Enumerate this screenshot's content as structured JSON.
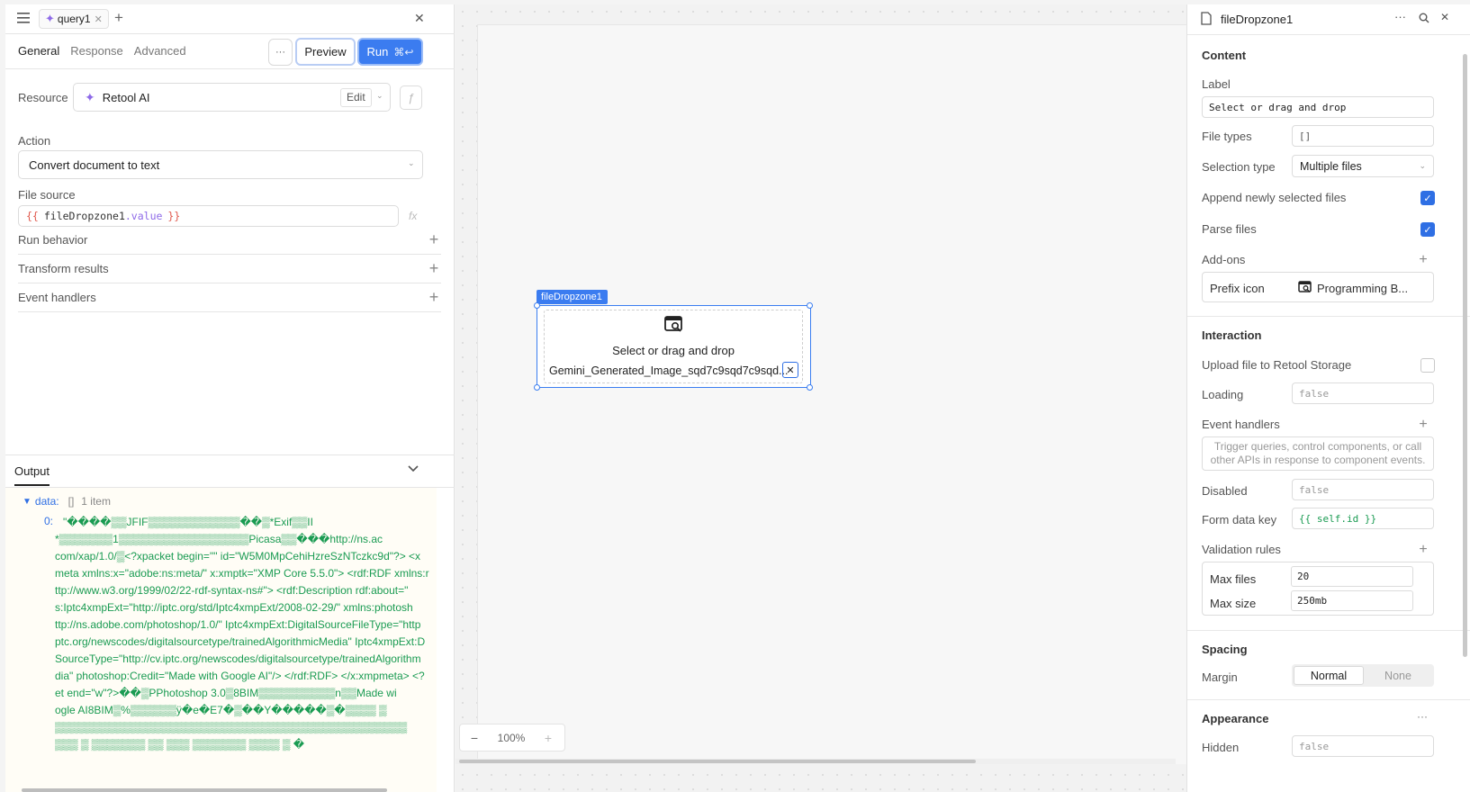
{
  "query": {
    "tab_name": "query1",
    "tabs": [
      "General",
      "Response",
      "Advanced"
    ],
    "preview_label": "Preview",
    "run_label": "Run",
    "run_shortcut": "⌘↩",
    "more_label": "···",
    "resource_label": "Resource",
    "resource_value": "Retool AI",
    "edit_label": "Edit",
    "action_label": "Action",
    "action_value": "Convert document to text",
    "file_source_label": "File source",
    "file_source_open": "{{",
    "file_source_expr": "fileDropzone1",
    "file_source_prop": ".value",
    "file_source_close": "}}",
    "fx_label": "fx",
    "sections": [
      "Run behavior",
      "Transform results",
      "Event handlers"
    ]
  },
  "output": {
    "title": "Output",
    "data_key": "data:",
    "data_bracket": "[]",
    "data_count": "1 item",
    "item_index": "0:",
    "lines": [
      "\"����▒▒JFIF▒▒▒▒▒▒▒▒▒▒▒▒��▒*Exif▒▒II",
      "*▒▒▒▒▒▒▒1▒▒▒▒▒▒▒▒▒▒▒▒▒▒▒▒▒Picasa▒▒���http://ns.ac",
      "com/xap/1.0/▒<?xpacket begin=\"\" id=\"W5M0MpCehiHzreSzNTczkc9d\"?> <x",
      "meta xmlns:x=\"adobe:ns:meta/\" x:xmptk=\"XMP Core 5.5.0\"> <rdf:RDF xmlns:r",
      "ttp://www.w3.org/1999/02/22-rdf-syntax-ns#\"> <rdf:Description rdf:about=\"",
      "s:Iptc4xmpExt=\"http://iptc.org/std/Iptc4xmpExt/2008-02-29/\" xmlns:photosh",
      "ttp://ns.adobe.com/photoshop/1.0/\" Iptc4xmpExt:DigitalSourceFileType=\"http",
      "ptc.org/newscodes/digitalsourcetype/trainedAlgorithmicMedia\" Iptc4xmpExt:D",
      "SourceType=\"http://cv.iptc.org/newscodes/digitalsourcetype/trainedAlgorithm",
      "dia\" photoshop:Credit=\"Made with Google AI\"/> </rdf:RDF> </x:xmpmeta> <?",
      "et end=\"w\"?>��▒PPhotoshop 3.0▒8BIM▒▒▒▒▒▒▒▒▒▒n▒▒Made wi",
      "ogle AI8BIM▒%▒▒▒▒▒▒ÿ�e�E7�▒��Y�����▒�▒▒▒▒ ▒",
      "▒▒▒▒▒▒▒▒▒▒▒▒▒▒▒▒▒▒▒▒▒▒▒▒▒▒▒▒▒▒▒▒▒▒▒▒▒▒▒▒▒▒▒▒▒▒",
      "▒▒▒ ▒ ▒▒▒▒▒▒▒ ▒▒ ▒▒▒ ▒▒▒▒▒▒▒ ▒▒▒▒ ▒ �"
    ]
  },
  "canvas": {
    "component_tag": "fileDropzone1",
    "dropzone_label": "Select or drag and drop",
    "file_name": "Gemini_Generated_Image_sqd7c9sqd7c9sqd...",
    "zoom": "100%",
    "zoom_minus": "−",
    "zoom_plus": "+"
  },
  "inspector": {
    "title": "fileDropzone1",
    "content_title": "Content",
    "label_label": "Label",
    "label_value": "Select or drag and drop",
    "file_types_label": "File types",
    "file_types_value": "[]",
    "selection_type_label": "Selection type",
    "selection_type_value": "Multiple files",
    "append_label": "Append newly selected files",
    "parse_label": "Parse files",
    "addons_label": "Add-ons",
    "prefix_icon_label": "Prefix icon",
    "prefix_icon_value": "Programming B...",
    "interaction_title": "Interaction",
    "upload_label": "Upload file to Retool Storage",
    "loading_label": "Loading",
    "loading_value": "false",
    "event_handlers_label": "Event handlers",
    "event_handlers_hint": "Trigger queries, control components, or call other APIs in response to component events.",
    "disabled_label": "Disabled",
    "disabled_value": "false",
    "form_key_label": "Form data key",
    "form_key_value": "{{ self.id }}",
    "validation_label": "Validation rules",
    "max_files_label": "Max files",
    "max_files_value": "20",
    "max_size_label": "Max size",
    "max_size_value": "250mb",
    "spacing_title": "Spacing",
    "margin_label": "Margin",
    "margin_options": [
      "Normal",
      "None"
    ],
    "appearance_title": "Appearance",
    "hidden_label": "Hidden",
    "hidden_value": "false"
  },
  "colors": {
    "accent": "#2f6fe4",
    "output_green": "#1a9b52"
  }
}
